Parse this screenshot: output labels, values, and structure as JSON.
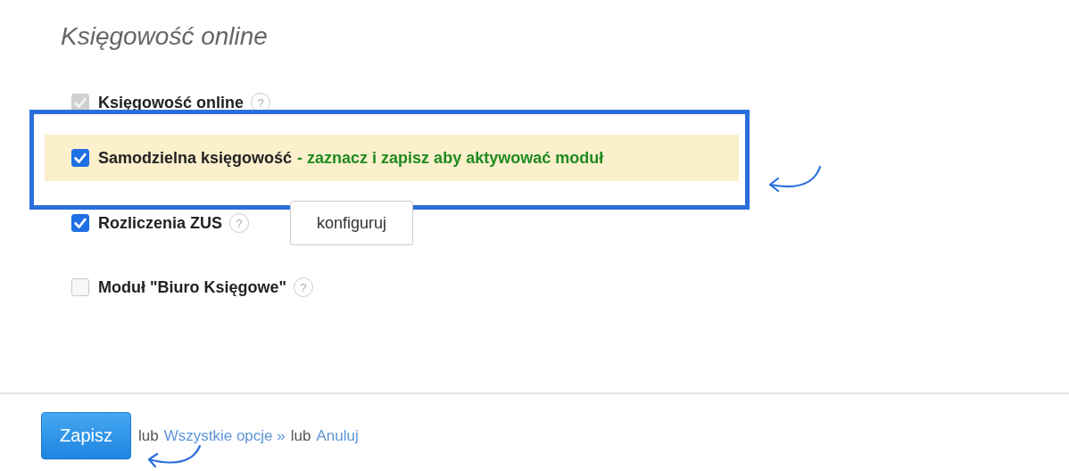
{
  "title": "Księgowość online",
  "modules": [
    {
      "label": "Księgowość online",
      "checked": true,
      "disabled": true,
      "highlighted": false,
      "help": "?"
    },
    {
      "label": "Samodzielna księgowość",
      "note": "- zaznacz i zapisz aby aktywować moduł",
      "checked": true,
      "disabled": false,
      "highlighted": true
    },
    {
      "label": "Rozliczenia ZUS",
      "checked": true,
      "disabled": false,
      "highlighted": false,
      "help": "?",
      "button": "konfiguruj"
    },
    {
      "label": "Moduł \"Biuro Księgowe\"",
      "checked": false,
      "disabled": false,
      "highlighted": false,
      "help": "?"
    }
  ],
  "footer": {
    "save": "Zapisz",
    "parts": [
      {
        "kind": "text",
        "text": "lub"
      },
      {
        "kind": "link",
        "text": "Wszystkie opcje »"
      },
      {
        "kind": "text",
        "text": "lub"
      },
      {
        "kind": "link",
        "text": "Anuluj"
      }
    ]
  }
}
